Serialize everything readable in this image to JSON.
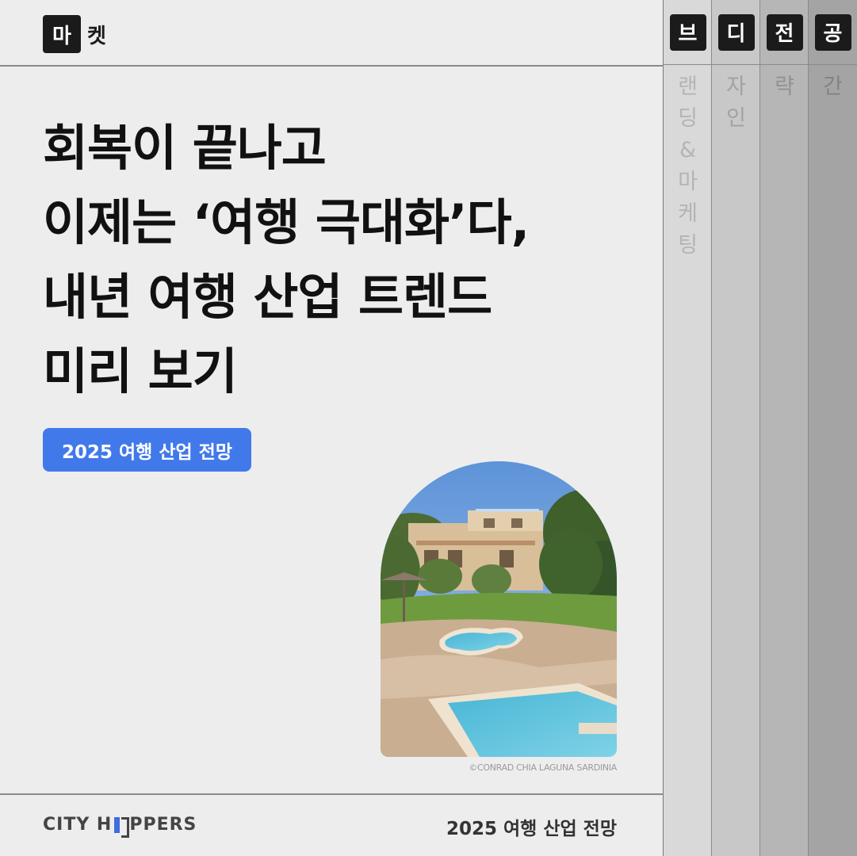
{
  "tabs": [
    {
      "box": "마",
      "rest": [
        "켓"
      ]
    },
    {
      "box": "브",
      "rest": [
        "랜",
        "딩",
        "&",
        "마",
        "케",
        "팅"
      ]
    },
    {
      "box": "디",
      "rest": [
        "자",
        "인"
      ]
    },
    {
      "box": "전",
      "rest": [
        "략"
      ]
    },
    {
      "box": "공",
      "rest": [
        "간"
      ]
    }
  ],
  "headline": {
    "line1": "회복이 끝나고",
    "line2": "이제는 ‘여행 극대화’다,",
    "line3": "내년 여행 산업 트렌드",
    "line4": "미리 보기"
  },
  "badge": "2025 여행 산업 전망",
  "photo_credit": "©CONRAD CHIA LAGUNA SARDINIA",
  "footer": {
    "brand_left": "CITY H",
    "brand_right": "PPERS",
    "title": "2025 여행 산업 전망"
  },
  "colors": {
    "accent": "#4279ea",
    "background": "#ededed",
    "dark": "#1b1b1b"
  }
}
